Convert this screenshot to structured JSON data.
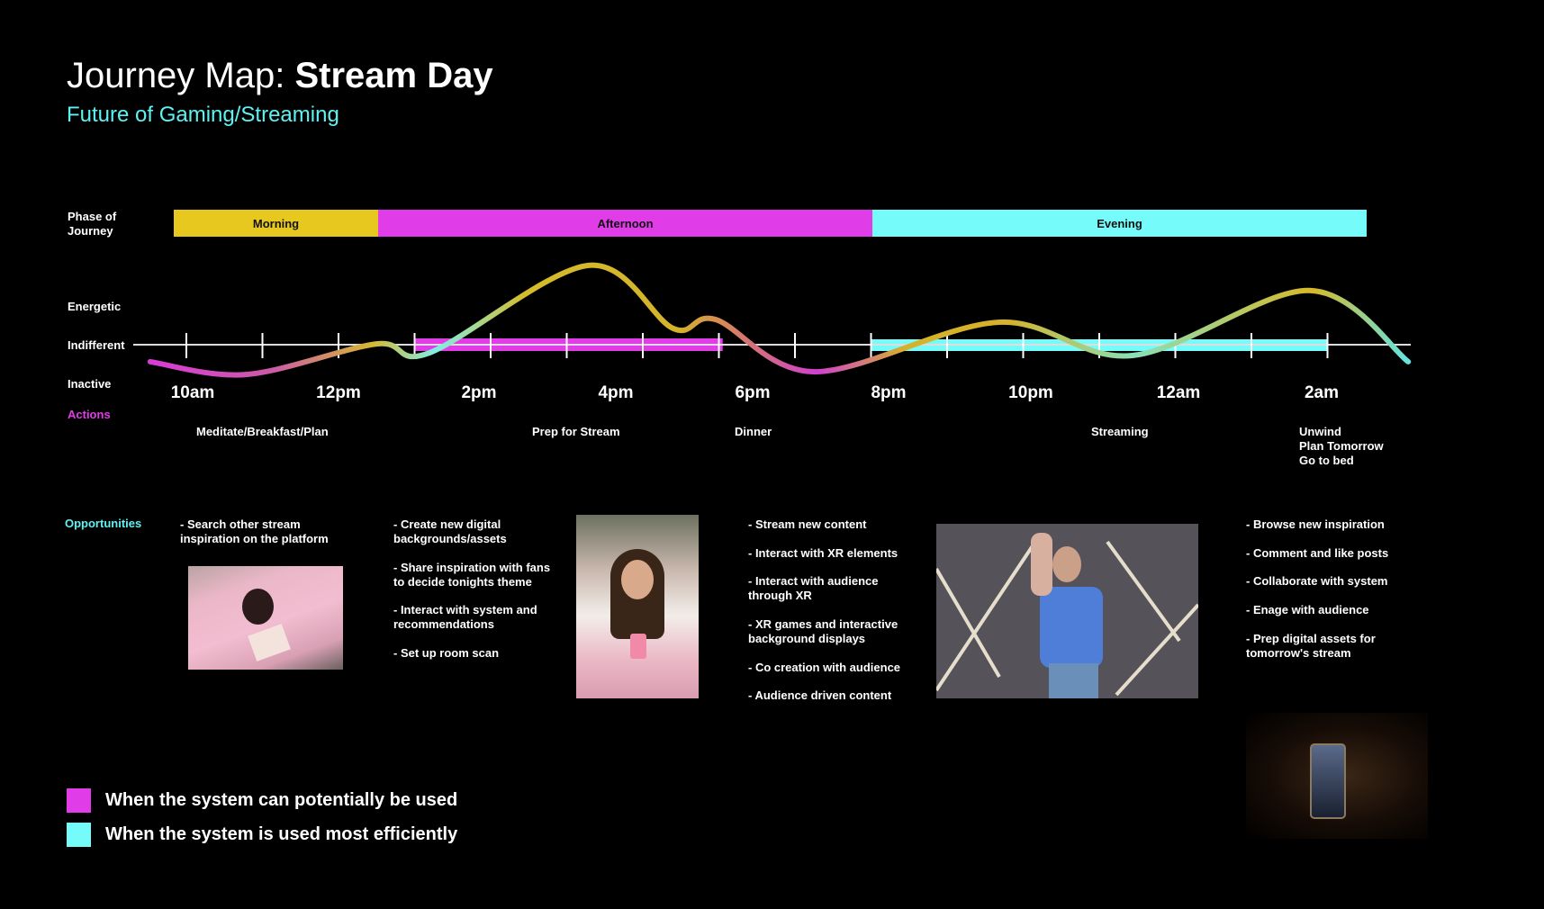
{
  "header": {
    "title_prefix": "Journey Map: ",
    "title_bold": "Stream Day",
    "subtitle": "Future of Gaming/Streaming"
  },
  "colors": {
    "morning": "#e6c81f",
    "afternoon": "#e03ce8",
    "evening": "#76fbfb",
    "subtitle": "#5ef2f2",
    "actions_label": "#e03ce8",
    "opportunities_label": "#5ef2f2"
  },
  "row_labels": {
    "phase": "Phase of\nJourney",
    "energetic": "Energetic",
    "indifferent": "Indifferent",
    "inactive": "Inactive",
    "actions": "Actions",
    "opportunities": "Opportunities"
  },
  "phases": [
    {
      "label": "Morning",
      "start_hour": 9.73,
      "end_hour": 12.6,
      "color": "#e6c81f"
    },
    {
      "label": "Afternoon",
      "start_hour": 12.6,
      "end_hour": 19.6,
      "color": "#e03ce8"
    },
    {
      "label": "Evening",
      "start_hour": 19.6,
      "end_hour": 26.6,
      "color": "#76fbfb"
    }
  ],
  "time_labels": [
    "10am",
    "12pm",
    "2pm",
    "4pm",
    "6pm",
    "8pm",
    "10pm",
    "12am",
    "2am"
  ],
  "emotion_curve": {
    "levels": {
      "inactive": -1,
      "indifferent": 0,
      "energetic": 1
    },
    "points": [
      [
        9.4,
        -0.44
      ],
      [
        10.76,
        -0.77
      ],
      [
        12.6,
        0.02
      ],
      [
        13.35,
        -0.21
      ],
      [
        15.6,
        2.05
      ],
      [
        16.8,
        0.42
      ],
      [
        17.4,
        0.65
      ],
      [
        18.8,
        -0.7
      ],
      [
        21.4,
        0.58
      ],
      [
        23.3,
        -0.28
      ],
      [
        25.8,
        1.4
      ],
      [
        27.2,
        -0.44
      ]
    ]
  },
  "system_use": [
    {
      "type": "potential",
      "start_hour": 13.15,
      "end_hour": 17.5,
      "color": "#e03ce8"
    },
    {
      "type": "efficient",
      "start_hour": 19.6,
      "end_hour": 26.06,
      "color": "#76fbfb"
    }
  ],
  "actions": [
    {
      "label": "Meditate/Breakfast/Plan"
    },
    {
      "label": "Prep for Stream"
    },
    {
      "label": "Dinner"
    },
    {
      "label": "Streaming"
    },
    {
      "label": "Unwind\nPlan Tomorrow\nGo to bed"
    }
  ],
  "opportunities": [
    {
      "items": [
        "- Search other stream\n  inspiration on the platform"
      ]
    },
    {
      "items": [
        "- Create new digital\n  backgrounds/assets",
        "- Share inspiration with fans\n  to decide tonights theme",
        "- Interact with system and\n  recommendations",
        "- Set up room scan"
      ]
    },
    {
      "items": [
        "- Stream new content",
        "- Interact with XR elements",
        "- Interact with audience\n  through XR",
        "- XR games and interactive\n  background displays",
        "- Co creation with audience",
        "- Audience driven content"
      ]
    },
    {
      "items": [
        "- Browse new inspiration",
        "- Comment and like posts",
        "- Collaborate with system",
        "- Enage with audience",
        "- Prep digital assets for\n  tomorrow's stream"
      ]
    }
  ],
  "legend": [
    {
      "label": "When the system can potentially be used",
      "color": "#e03ce8"
    },
    {
      "label": "When the system is used most efficiently",
      "color": "#76fbfb"
    }
  ]
}
